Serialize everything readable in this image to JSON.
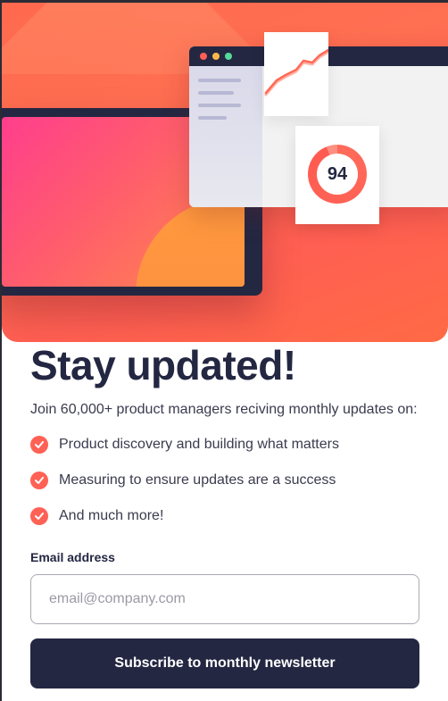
{
  "hero": {
    "illustration_icons": [
      "laptop-illustration",
      "browser-window-illustration",
      "line-chart-icon",
      "score-ring-icon"
    ],
    "score": "94",
    "colors": {
      "accent": "#ff6155",
      "dark": "#242742"
    }
  },
  "content": {
    "title": "Stay updated!",
    "intro": "Join 60,000+ product managers reciving monthly updates on:",
    "benefits": [
      {
        "icon": "check-icon",
        "text": "Product discovery and building what matters"
      },
      {
        "icon": "check-icon",
        "text": "Measuring to ensure updates are a success"
      },
      {
        "icon": "check-icon",
        "text": "And much more!"
      }
    ]
  },
  "form": {
    "email_label": "Email address",
    "email_placeholder": "email@company.com",
    "email_value": "",
    "submit_label": "Subscribe to monthly newsletter"
  }
}
